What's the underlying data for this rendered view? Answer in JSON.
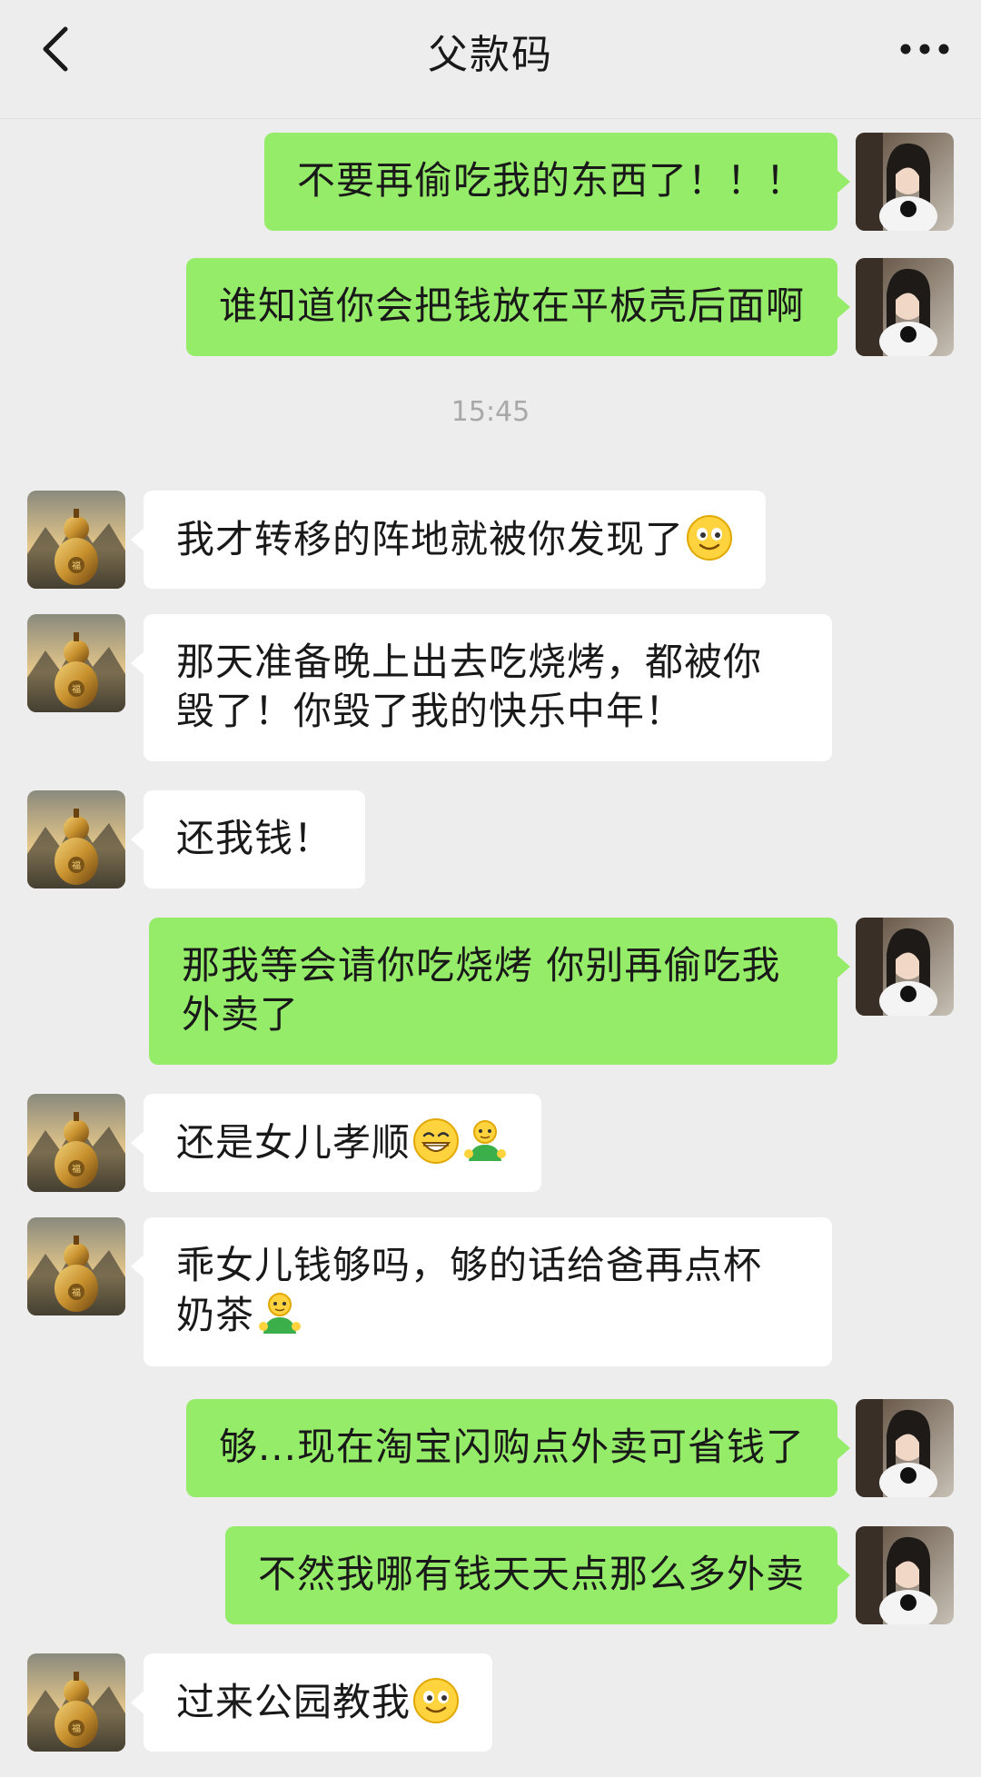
{
  "header": {
    "title": "父款码",
    "back_icon": "chevron-left-icon",
    "more_icon": "more-horizontal-icon"
  },
  "colors": {
    "background": "#ededed",
    "sent_bubble": "#95ec69",
    "received_bubble": "#ffffff",
    "timestamp_text": "#a8a8a8"
  },
  "messages": [
    {
      "side": "right",
      "text": "不要再偷吃我的东西了！！！"
    },
    {
      "side": "right",
      "text": "谁知道你会把钱放在平板壳后面啊"
    },
    {
      "timestamp": "15:45"
    },
    {
      "side": "left",
      "text": "我才转移的阵地就被你发现了",
      "emoji": [
        "smile-emoji"
      ]
    },
    {
      "side": "left",
      "text_lines": [
        "那天准备晚上出去吃烧烤，都被你",
        "毁了！你毁了我的快乐中年！"
      ]
    },
    {
      "side": "left",
      "text": "还我钱！"
    },
    {
      "side": "right",
      "text_lines": [
        "那我等会请你吃烧烤 你别再偷吃我",
        "外卖了"
      ]
    },
    {
      "side": "left",
      "text": "还是女儿孝顺",
      "emoji": [
        "grin-emoji",
        "person-emoji"
      ]
    },
    {
      "side": "left",
      "text_lines": [
        "乖女儿钱够吗，够的话给爸再点杯",
        "奶茶"
      ],
      "emoji": [
        "person-emoji"
      ]
    },
    {
      "side": "right",
      "text": "够...现在淘宝闪购点外卖可省钱了"
    },
    {
      "side": "right",
      "text": "不然我哪有钱天天点那么多外卖"
    },
    {
      "side": "left",
      "text": "过来公园教我",
      "emoji": [
        "smile-emoji"
      ]
    }
  ]
}
